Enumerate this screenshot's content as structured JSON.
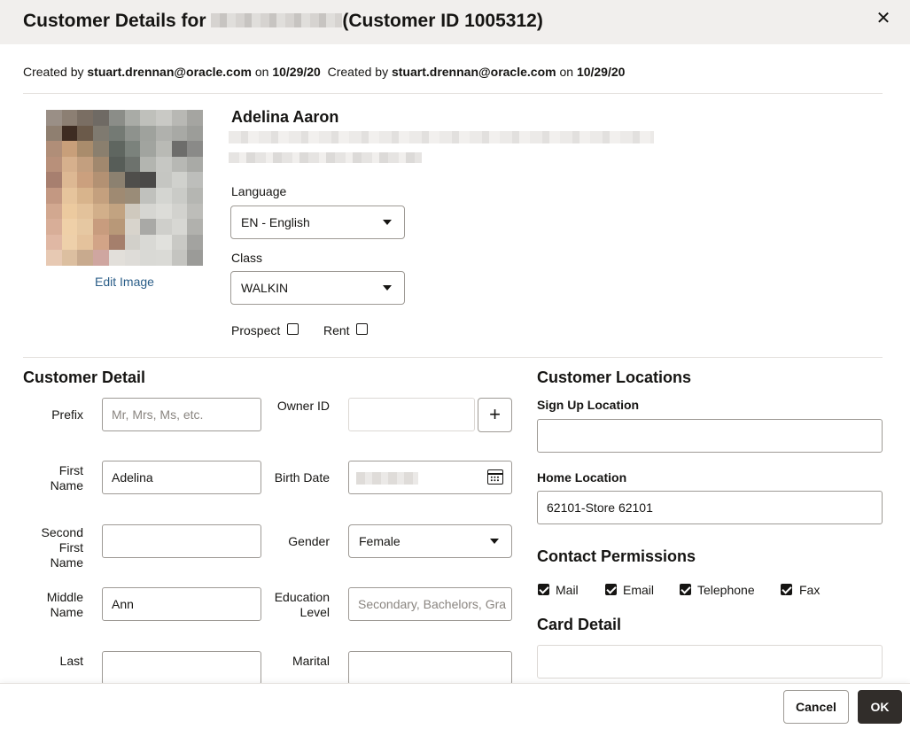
{
  "dialog": {
    "title_prefix": "Customer Details for",
    "title_suffix": "(Customer ID 1005312)",
    "close_icon": "close-icon"
  },
  "meta": {
    "created_label": "Created by",
    "created_by": "stuart.drennan@oracle.com",
    "on_label": "on",
    "created_date": "10/29/20",
    "created_label2": "Created by",
    "created_by2": "stuart.drennan@oracle.com",
    "on_label2": "on",
    "created_date2": "10/29/20"
  },
  "profile": {
    "edit_image": "Edit Image",
    "name": "Adelina Aaron",
    "language_label": "Language",
    "language_value": "EN - English",
    "class_label": "Class",
    "class_value": "WALKIN",
    "prospect_label": "Prospect",
    "rent_label": "Rent"
  },
  "customer_detail": {
    "heading": "Customer Detail",
    "prefix_label": "Prefix",
    "prefix_placeholder": "Mr, Mrs, Ms, etc.",
    "owner_label": "Owner ID",
    "first_name_label_1": "First",
    "first_name_label_2": "Name",
    "first_name_value": "Adelina",
    "birth_label": "Birth Date",
    "second_label_1": "Second",
    "second_label_2": "First",
    "second_label_3": "Name",
    "gender_label": "Gender",
    "gender_value": "Female",
    "middle_label_1": "Middle",
    "middle_label_2": "Name",
    "middle_value": "Ann",
    "education_label_1": "Education",
    "education_label_2": "Level",
    "education_placeholder": "Secondary, Bachelors, Gra",
    "last_label": "Last",
    "marital_label": "Marital"
  },
  "locations": {
    "heading": "Customer Locations",
    "signup_label": "Sign Up Location",
    "home_label": "Home Location",
    "home_value": "62101-Store 62101"
  },
  "permissions": {
    "heading": "Contact Permissions",
    "mail": "Mail",
    "email": "Email",
    "telephone": "Telephone",
    "fax": "Fax"
  },
  "card": {
    "heading": "Card Detail"
  },
  "footer": {
    "cancel": "Cancel",
    "ok": "OK"
  }
}
